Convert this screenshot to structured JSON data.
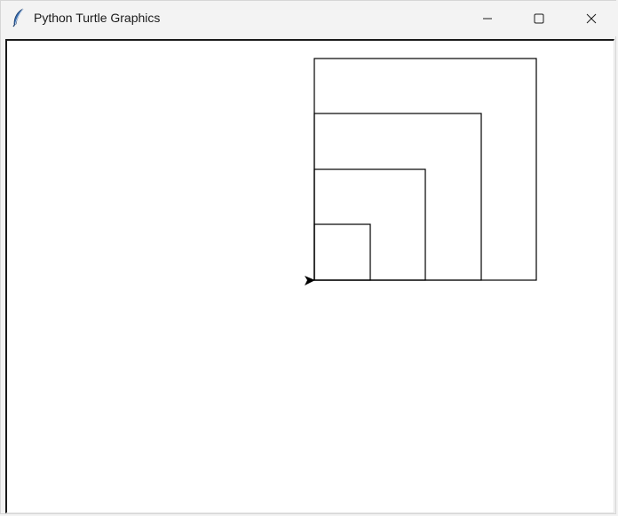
{
  "window": {
    "title": "Python Turtle Graphics",
    "app_icon": "feather-icon",
    "controls": [
      "minimize-icon",
      "maximize-icon",
      "close-icon"
    ]
  },
  "canvas": {
    "background": "#ffffff",
    "stroke_color": "#000000",
    "turtle_heading": "east",
    "squares_drawn": 4
  }
}
